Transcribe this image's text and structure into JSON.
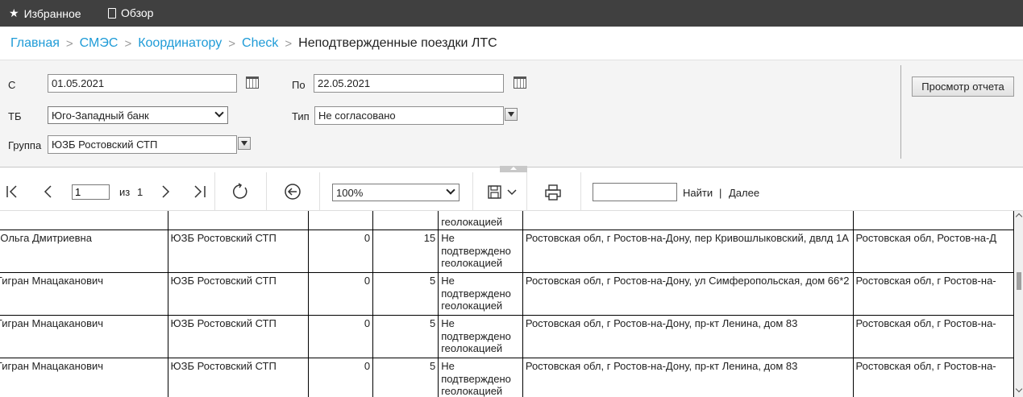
{
  "topbar": {
    "favorites_label": "Избранное",
    "browse_label": "Обзор"
  },
  "breadcrumb": {
    "items": [
      "Главная",
      "СМЭС",
      "Координатору",
      "Check"
    ],
    "current": "Неподтвержденные поездки ЛТС"
  },
  "params": {
    "from_label": "С",
    "from_value": "01.05.2021",
    "to_label": "По",
    "to_value": "22.05.2021",
    "tb_label": "ТБ",
    "tb_value": "Юго-Западный банк",
    "type_label": "Тип",
    "type_value": "Не согласовано",
    "group_label": "Группа",
    "group_value": "ЮЗБ Ростовский СТП",
    "view_report_label": "Просмотр отчета"
  },
  "toolbar": {
    "page_value": "1",
    "of_label": "из",
    "total_pages": "1",
    "zoom_value": "100%",
    "find_label": "Найти",
    "separator": "|",
    "next_label": "Далее",
    "find_placeholder": ""
  },
  "report": {
    "rows": [
      {
        "name": "",
        "group": "",
        "c1": "",
        "c2": "",
        "status": "геолокацией",
        "addr1": "",
        "addr2": ""
      },
      {
        "name": "ская Ольга Дмитриевна",
        "group": "ЮЗБ Ростовский СТП",
        "c1": "0",
        "c2": "15",
        "status": "Не подтверждено геолокацией",
        "addr1": "Ростовская обл, г Ростов-на-Дону, пер Кривошлыковский, двлд 1А",
        "addr2": "Ростовская обл, Ростов-на-Д"
      },
      {
        "name": "рян Тигран Мнацаканович",
        "group": "ЮЗБ Ростовский СТП",
        "c1": "0",
        "c2": "5",
        "status": "Не подтверждено геолокацией",
        "addr1": "Ростовская обл, г Ростов-на-Дону, ул Симферопольская, дом 66*2",
        "addr2": "Ростовская обл, г Ростов-на-"
      },
      {
        "name": "рян Тигран Мнацаканович",
        "group": "ЮЗБ Ростовский СТП",
        "c1": "0",
        "c2": "5",
        "status": "Не подтверждено геолокацией",
        "addr1": "Ростовская обл, г Ростов-на-Дону, пр-кт Ленина, дом 83",
        "addr2": "Ростовская обл, г Ростов-на-"
      },
      {
        "name": "рян Тигран Мнацаканович",
        "group": "ЮЗБ Ростовский СТП",
        "c1": "0",
        "c2": "5",
        "status": "Не подтверждено геолокацией",
        "addr1": "Ростовская обл, г Ростов-на-Дону, пр-кт Ленина, дом 83",
        "addr2": "Ростовская обл, г Ростов-на-"
      }
    ]
  },
  "icons": {
    "favorites": "star-icon",
    "browse": "document-icon",
    "calendar": "calendar-icon",
    "first": "first-page-icon",
    "prev": "previous-page-icon",
    "next": "next-page-icon",
    "last": "last-page-icon",
    "refresh": "refresh-icon",
    "back": "back-icon",
    "save": "save-icon",
    "print": "print-icon"
  },
  "colors": {
    "topbar": "#404040",
    "link": "#1e9bd7",
    "panel": "#f4f4f4"
  }
}
